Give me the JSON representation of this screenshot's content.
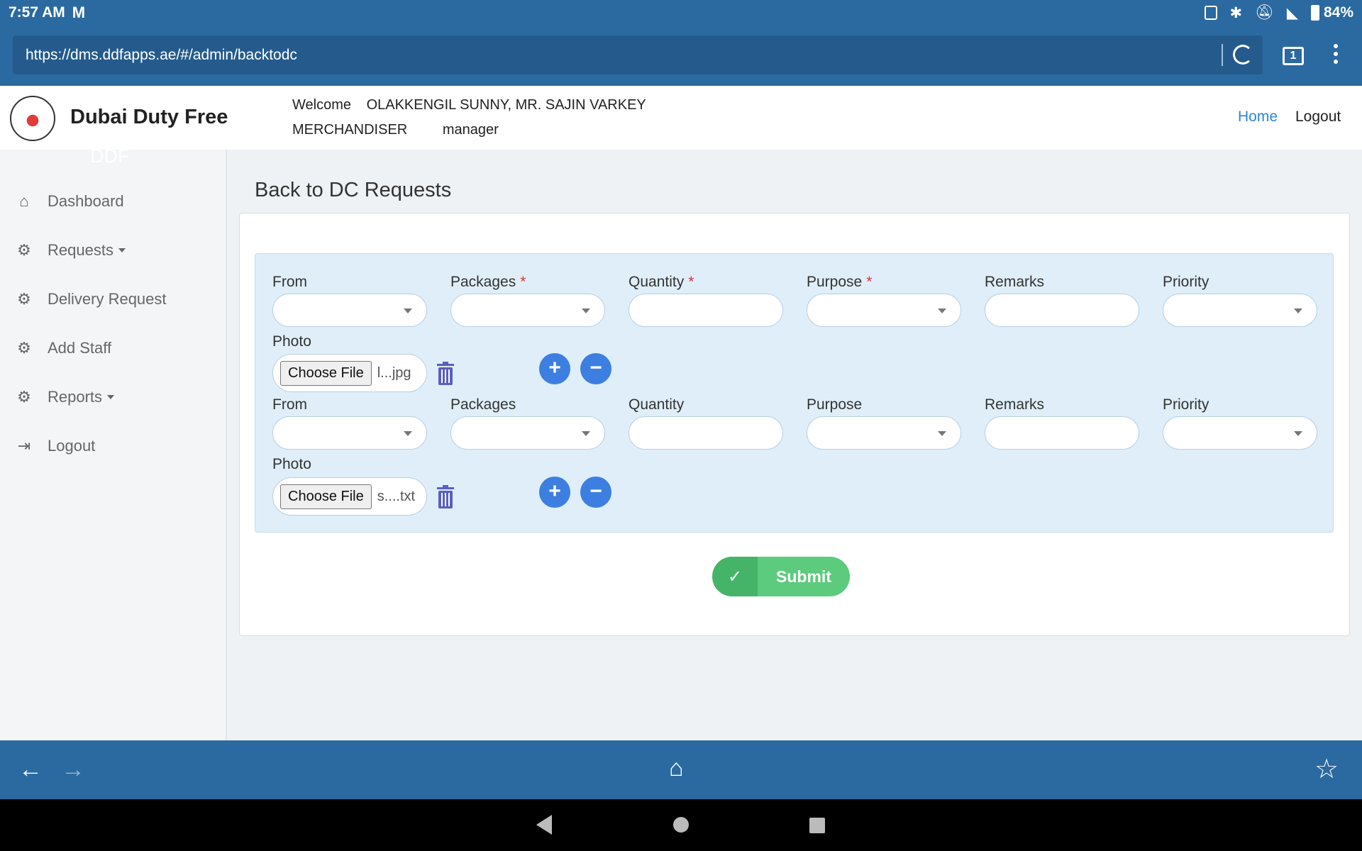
{
  "status_bar": {
    "time": "7:57 AM",
    "app_icon": "gmail-icon",
    "battery": "84%",
    "icons": [
      "nfc-icon",
      "bluetooth-icon",
      "mute-icon",
      "wifi-icon",
      "battery-icon"
    ]
  },
  "browser": {
    "url": "https://dms.ddfapps.ae/#/admin/backtodc",
    "tab_count": "1"
  },
  "header": {
    "brand": "Dubai Duty Free",
    "welcome_label": "Welcome",
    "user_name": "OLAKKENGIL SUNNY, MR. SAJIN VARKEY",
    "role": "MERCHANDISER",
    "level": "manager",
    "nav_home": "Home",
    "nav_logout": "Logout",
    "ghost_text": "DDF"
  },
  "sidebar": {
    "items": [
      {
        "label": "Dashboard",
        "icon": "home-icon"
      },
      {
        "label": "Requests",
        "icon": "gear-icon",
        "dropdown": true
      },
      {
        "label": "Delivery Request",
        "icon": "gear-icon"
      },
      {
        "label": "Add Staff",
        "icon": "gear-icon"
      },
      {
        "label": "Reports",
        "icon": "gear-icon",
        "dropdown": true
      },
      {
        "label": "Logout",
        "icon": "sign-out-icon"
      }
    ]
  },
  "main": {
    "title": "Back to DC Requests",
    "labels": {
      "from": "From",
      "packages": "Packages",
      "quantity": "Quantity",
      "purpose": "Purpose",
      "remarks": "Remarks",
      "priority": "Priority",
      "photo": "Photo",
      "required_mark": "*"
    },
    "rows": [
      {
        "file_button": "Choose File",
        "file_name": "l...jpg",
        "required": true
      },
      {
        "file_button": "Choose File",
        "file_name": "s....txt",
        "required": false
      }
    ],
    "submit_label": "Submit"
  },
  "colors": {
    "browser_blue": "#2b6aa0",
    "accent_blue": "#3d7fe0",
    "link_blue": "#2a86d8",
    "submit_green": "#5ccb7d",
    "panel_bg": "#dfeef8",
    "required_red": "#d9363e"
  }
}
